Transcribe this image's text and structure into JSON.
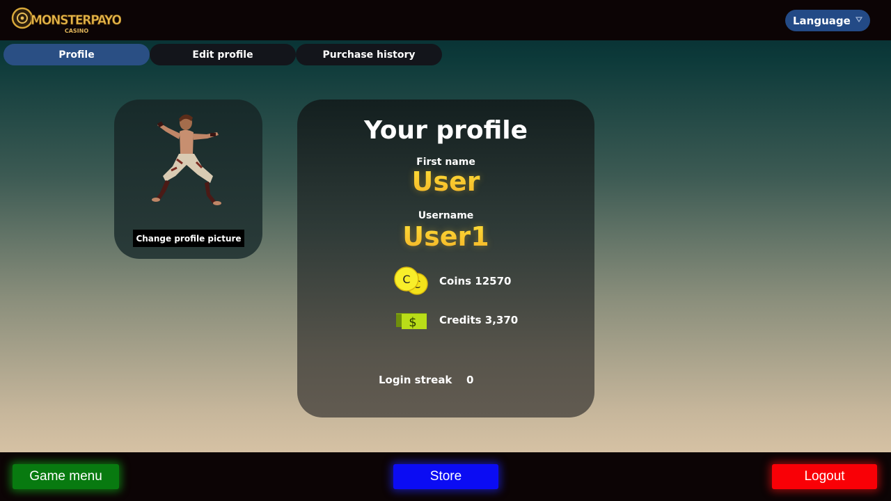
{
  "header": {
    "logo_text": "MONSTERPAYOUT",
    "logo_subtext": "CASINO",
    "language_label": "Language"
  },
  "tabs": [
    {
      "label": "Profile",
      "active": true
    },
    {
      "label": "Edit profile",
      "active": false
    },
    {
      "label": "Purchase history",
      "active": false
    }
  ],
  "avatar": {
    "change_picture_label": "Change profile picture"
  },
  "profile": {
    "title": "Your profile",
    "first_name_label": "First name",
    "first_name_value": "User",
    "username_label": "Username",
    "username_value": "User1",
    "coins_text": "Coins 12570",
    "credits_text": "Credits 3,370",
    "login_streak_label": "Login streak",
    "login_streak_value": "0"
  },
  "footer": {
    "game_menu_label": "Game menu",
    "store_label": "Store",
    "logout_label": "Logout"
  },
  "colors": {
    "game_menu": "#087a10",
    "store": "#0b0cf3",
    "logout": "#f90006",
    "active_tab": "#2a4f84",
    "gold_text": "#f1c232"
  }
}
